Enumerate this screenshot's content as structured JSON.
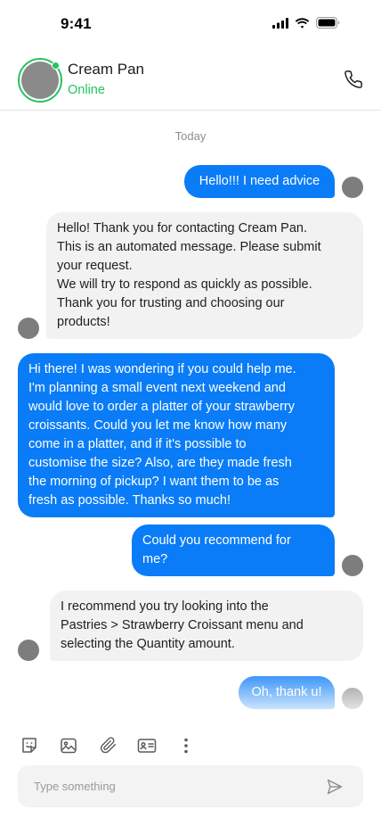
{
  "status_bar": {
    "time": "9:41"
  },
  "header": {
    "contact_name": "Cream Pan",
    "contact_status": "Online",
    "call_icon": "phone-icon"
  },
  "conversation": {
    "date_separator": "Today",
    "messages": [
      {
        "direction": "outgoing",
        "lines": [
          "Hello!!! I need advice"
        ]
      },
      {
        "direction": "incoming",
        "lines": [
          "Hello! Thank you for contacting Cream Pan.",
          "This is an automated message. Please submit",
          "your request.",
          "We will try to respond as quickly as possible.",
          "Thank you for trusting and choosing our",
          "products!"
        ]
      },
      {
        "direction": "outgoing",
        "lines": [
          "Hi there! I was wondering if you could help me.",
          "I'm planning a small event next weekend and",
          "would love to order a platter of your strawberry",
          "croissants. Could you let me know how many",
          "come in a platter, and if it's possible to",
          "customise the size? Also, are they made fresh",
          "the morning of pickup? I want them to be as",
          "fresh as possible. Thanks so much!"
        ]
      },
      {
        "direction": "outgoing",
        "lines": [
          "Could you recommend for",
          "me?"
        ]
      },
      {
        "direction": "incoming",
        "lines": [
          "I recommend you try looking into the",
          "Pastries > Strawberry Croissant menu and",
          "selecting the Quantity amount."
        ]
      },
      {
        "direction": "outgoing",
        "lines": [
          "Oh, thank u!"
        ]
      }
    ]
  },
  "composer": {
    "tools": [
      "sticker-icon",
      "image-icon",
      "attachment-icon",
      "contact-card-icon",
      "more-vertical-icon"
    ],
    "input_placeholder": "Type something",
    "input_value": "",
    "send_icon": "send-icon"
  },
  "colors": {
    "accent": "#0a7cf7",
    "online": "#22c55e",
    "incoming_bubble": "#f2f2f2"
  }
}
